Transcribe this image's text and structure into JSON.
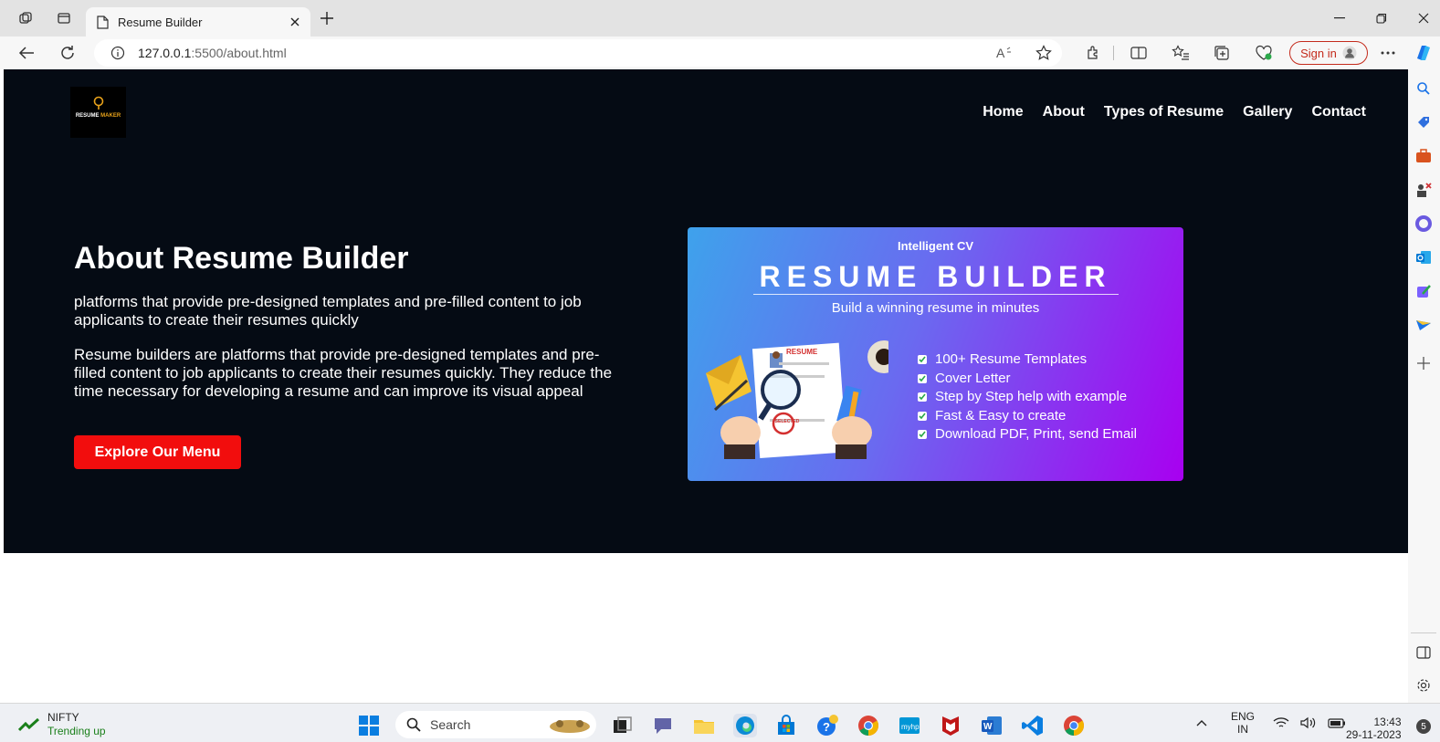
{
  "browser": {
    "tab_title": "Resume Builder",
    "url_host": "127.0.0.1",
    "url_path": ":5500/about.html",
    "sign_in_label": "Sign in"
  },
  "site": {
    "logo_line1": "RESUME",
    "logo_line2": "MAKER",
    "nav": [
      "Home",
      "About",
      "Types of Resume",
      "Gallery",
      "Contact"
    ],
    "heading": "About Resume Builder",
    "paragraph1": "platforms that provide pre-designed templates and pre-filled content to job applicants to create their resumes quickly",
    "paragraph2": "Resume builders are platforms that provide pre-designed templates and pre-filled content to job applicants to create their resumes quickly. They reduce the time necessary for developing a resume and can improve its visual appeal",
    "cta_label": "Explore Our Menu"
  },
  "banner": {
    "subtitle": "Intelligent CV",
    "title": "RESUME BUILDER",
    "tagline": "Build a winning resume in minutes",
    "paper_label": "RESUME",
    "stamp_label": "SELECTED",
    "features": [
      "100+ Resume Templates",
      "Cover Letter",
      "Step by Step help with example",
      "Fast & Easy to create",
      "Download PDF, Print, send Email"
    ]
  },
  "taskbar": {
    "ticker_name": "NIFTY",
    "ticker_status": "Trending up",
    "search_placeholder": "Search",
    "lang_line1": "ENG",
    "lang_line2": "IN",
    "time": "13:43",
    "date": "29-11-2023",
    "notification_count": "5"
  },
  "colors": {
    "hero_bg": "#050b14",
    "cta_bg": "#f20d0d",
    "sign_in": "#c42b1c",
    "banner_start": "#3ea2ec",
    "banner_end": "#a800f0"
  }
}
